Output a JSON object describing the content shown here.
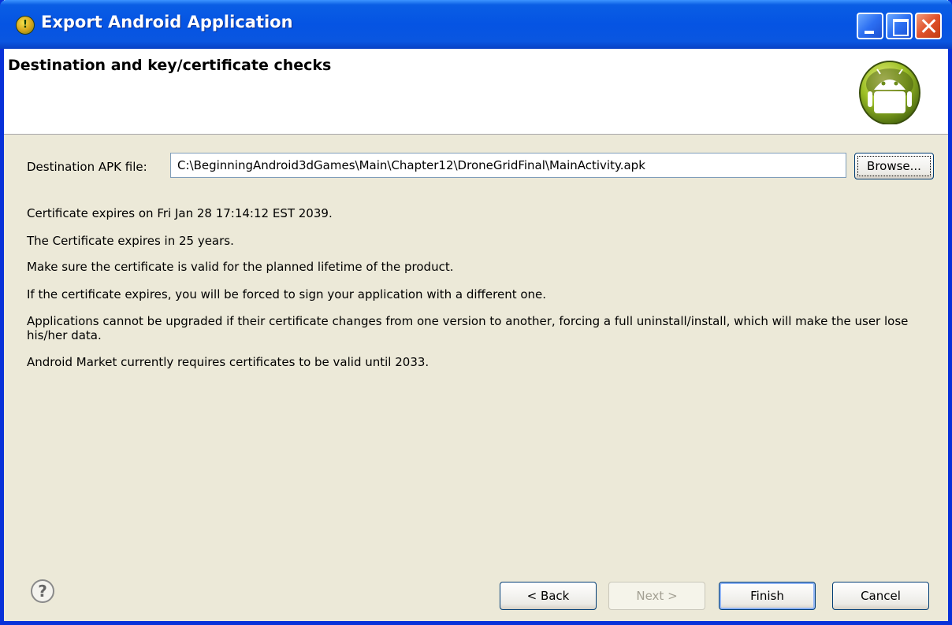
{
  "window": {
    "title": "Export Android Application"
  },
  "header": {
    "title": "Destination and key/certificate checks"
  },
  "destination": {
    "label": "Destination APK file:",
    "value": "C:\\BeginningAndroid3dGames\\Main\\Chapter12\\DroneGridFinal\\MainActivity.apk",
    "browse_label": "Browse..."
  },
  "messages": [
    "Certificate expires on Fri Jan 28 17:14:12 EST 2039.",
    "The Certificate expires in 25 years.",
    "Make sure the certificate is valid for the planned lifetime of the product.",
    "If the certificate expires, you will be forced to sign your application with a different one.",
    "Applications cannot be upgraded if their certificate changes from one version to another, forcing a full uninstall/install, which will make the user lose his/her data.",
    "Android Market currently requires certificates to be valid until 2033."
  ],
  "footer": {
    "help_icon": "?",
    "back_label": "< Back",
    "next_label": "Next >",
    "finish_label": "Finish",
    "cancel_label": "Cancel"
  },
  "icons": {
    "app": "android-adt-icon",
    "logo": "android-logo-icon"
  },
  "colors": {
    "titlebar": "#0554e3",
    "dialog_bg": "#ece9d8",
    "header_bg": "#ffffff",
    "android_green": "#a4c639"
  }
}
